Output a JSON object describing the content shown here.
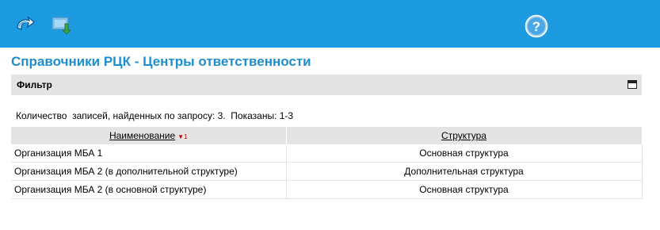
{
  "toolbar": {
    "back_icon": "undo-icon",
    "export_icon": "export-icon",
    "help_icon": "help-icon",
    "background": "#1c9be0"
  },
  "page": {
    "title": "Справочники РЦК - Центры ответственности",
    "title_color": "#1c8fd1"
  },
  "filter": {
    "label": "Фильтр",
    "toggle_icon": "maximize-icon"
  },
  "summary": {
    "text": "Количество  записей, найденных по запросу: 3.  Показаны: 1-3"
  },
  "table": {
    "columns": [
      {
        "label": "Наименование",
        "sort_mark": "▼1"
      },
      {
        "label": "Структура"
      }
    ],
    "rows": [
      {
        "name": "Организация МБА 1",
        "structure": "Основная структура"
      },
      {
        "name": "Организация МБА 2 (в дополнительной структуре)",
        "structure": "Дополнительная структура"
      },
      {
        "name": "Организация МБА 2 (в основной структуре)",
        "structure": "Основная структура"
      }
    ]
  }
}
